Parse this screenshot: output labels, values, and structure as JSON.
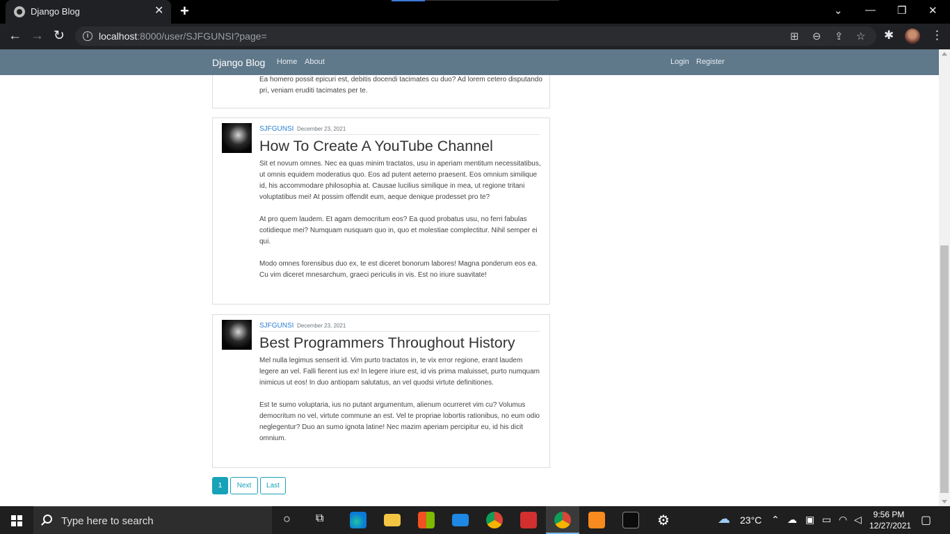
{
  "browser": {
    "tab_title": "Django Blog",
    "tab_close": "✕",
    "new_tab": "+",
    "url_host": "localhost",
    "url_rest": ":8000/user/SJFGUNSI?page=",
    "window_controls": {
      "minimize": "—",
      "restore": "❐",
      "close": "✕",
      "dropdown": "⌄"
    }
  },
  "navbar": {
    "brand": "Django Blog",
    "links": [
      "Home",
      "About"
    ],
    "right_links": [
      "Login",
      "Register"
    ]
  },
  "posts": [
    {
      "partial": true,
      "text": "Ea homero possit epicuri est, debitis docendi tacimates cu duo? Ad lorem cetero disputando pri, veniam eruditi tacimates per te."
    },
    {
      "author": "SJFGUNSI",
      "date": "December 23, 2021",
      "title": "How To Create A YouTube Channel",
      "paragraphs": [
        "Sit et novum omnes. Nec ea quas minim tractatos, usu in aperiam mentitum necessitatibus, ut omnis equidem moderatius quo. Eos ad putent aeterno praesent. Eos omnium similique id, his accommodare philosophia at. Causae lucilius similique in mea, ut regione tritani voluptatibus mei! At possim offendit eum, aeque denique prodesset pro te?",
        "At pro quem laudem. Et agam democritum eos? Ea quod probatus usu, no ferri fabulas cotidieque mei? Numquam nusquam quo in, quo et molestiae complectitur. Nihil semper ei qui.",
        "Modo omnes forensibus duo ex, te est diceret bonorum labores! Magna ponderum eos ea. Cu vim diceret mnesarchum, graeci periculis in vis. Est no iriure suavitate!"
      ]
    },
    {
      "author": "SJFGUNSI",
      "date": "December 23, 2021",
      "title": "Best Programmers Throughout History",
      "paragraphs": [
        "Mel nulla legimus senserit id. Vim purto tractatos in, te vix error regione, erant laudem legere an vel. Falli fierent ius ex! In legere iriure est, id vis prima maluisset, purto numquam inimicus ut eos! In duo antiopam salutatus, an vel quodsi virtute definitiones.",
        "Est te sumo voluptaria, ius no putant argumentum, alienum ocurreret vim cu? Volumus democritum no vel, virtute commune an est. Vel te propriae lobortis rationibus, no eum odio neglegentur? Duo an sumo ignota latine! Nec mazim aperiam percipitur eu, id his dicit omnium."
      ]
    }
  ],
  "pagination": {
    "current": "1",
    "next": "Next",
    "last": "Last"
  },
  "taskbar": {
    "search_placeholder": "Type here to search",
    "temperature": "23°C",
    "time": "9:56 PM",
    "date": "12/27/2021"
  }
}
